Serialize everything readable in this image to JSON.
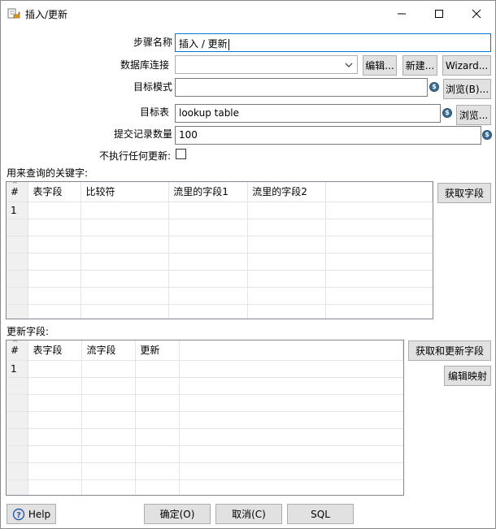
{
  "window": {
    "title": "插入/更新",
    "controls": [
      "minimize",
      "maximize",
      "close"
    ]
  },
  "form": {
    "step_name": {
      "label": "步骤名称",
      "value": "插入 / 更新"
    },
    "db_connection": {
      "label": "数据库连接",
      "value": "",
      "edit_button": "编辑...",
      "new_button": "新建...",
      "wizard_button": "Wizard..."
    },
    "target_schema": {
      "label": "目标模式",
      "value": "",
      "browse_button": "浏览(B)..."
    },
    "target_table": {
      "label": "目标表",
      "value": "lookup table",
      "browse_button": "浏览..."
    },
    "commit_size": {
      "label": "提交记录数量",
      "value": "100"
    },
    "no_update": {
      "label": "不执行任何更新:",
      "checked": false
    }
  },
  "lookup_keys": {
    "label": "用来查询的关键字:",
    "get_fields_button": "获取字段",
    "columns": [
      "#",
      "表字段",
      "比较符",
      "流里的字段1",
      "流里的字段2"
    ],
    "rows": [
      [
        "1",
        "",
        "",
        "",
        ""
      ]
    ]
  },
  "update_fields": {
    "label": "更新字段:",
    "get_update_fields_button": "获取和更新字段",
    "edit_mapping_button": "编辑映射",
    "columns": [
      "#",
      "表字段",
      "流字段",
      "更新"
    ],
    "rows": [
      [
        "1",
        "",
        "",
        ""
      ]
    ]
  },
  "footer": {
    "help_button": "Help",
    "ok_button": "确定(O)",
    "cancel_button": "取消(C)",
    "sql_button": "SQL"
  },
  "icons": {
    "app": "insert-update-step-icon",
    "variable": "dollar-variable-icon",
    "help": "help-icon"
  },
  "colors": {
    "focus_border": "#0078d7",
    "button_bg": "#e1e1e1",
    "variable_icon": "#3c6e94"
  }
}
